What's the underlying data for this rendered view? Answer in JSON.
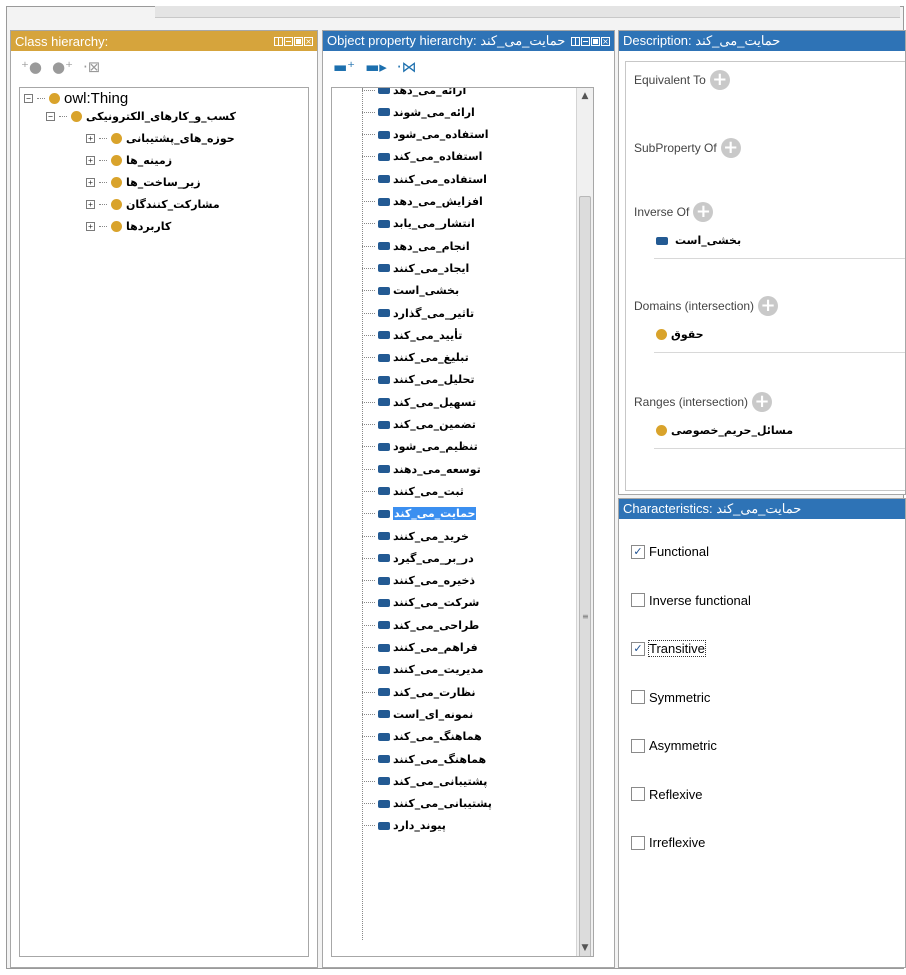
{
  "class_hierarchy": {
    "title": "Class hierarchy:",
    "root": "owl:Thing",
    "parent": "کسب_و_کارهای_الکترونیکی",
    "children": [
      "حوزه_های_پشتیبانی",
      "زمینه_ها",
      "زیر_ساخت_ها",
      "مشارکت_کنندگان",
      "کاربردها"
    ]
  },
  "object_property": {
    "title": "Object property hierarchy: حمایت_می_کند",
    "items": [
      "ارائه_می_دهد",
      "ارائه_می_شوند",
      "استفاده_می_شود",
      "استفاده_می_کند",
      "استفاده_می_کنند",
      "افزایش_می_دهد",
      "انتشار_می_یابد",
      "انجام_می_دهد",
      "ایجاد_می_کنند",
      "بخشی_است",
      "تاثیر_می_گذارد",
      "تأیید_می_کند",
      "تبلیغ_می_کنند",
      "تحلیل_می_کنند",
      "تسهیل_می_کند",
      "تضمین_می_کند",
      "تنظیم_می_شود",
      "توسعه_می_دهند",
      "ثبت_می_کنند",
      "حمایت_می_کند",
      "خرید_می_کنند",
      "در_بر_می_گیرد",
      "ذخیره_می_کنند",
      "شرکت_می_کنند",
      "طراحی_می_کند",
      "فراهم_می_کنند",
      "مدیریت_می_کنند",
      "نظارت_می_کند",
      "نمونه_ای_است",
      "هماهنگ_می_کند",
      "هماهنگ_می_کنند",
      "پشتیبانی_می_کند",
      "پشتیبانی_می_کنند",
      "پیوند_دارد"
    ],
    "selected_index": 19
  },
  "description": {
    "title": "Description: حمایت_می_کند",
    "equivalent_to": "Equivalent To",
    "subproperty_of": "SubProperty Of",
    "inverse_of": "Inverse Of",
    "inverse_value": "بخشی_است",
    "domains": "Domains (intersection)",
    "domain_value": "حقوق",
    "ranges": "Ranges (intersection)",
    "range_value": "مسائل_حریم_خصوصی"
  },
  "characteristics": {
    "title": "Characteristics: حمایت_می_کند",
    "items": [
      {
        "label": "Functional",
        "checked": true
      },
      {
        "label": "Inverse functional",
        "checked": false
      },
      {
        "label": "Transitive",
        "checked": true
      },
      {
        "label": "Symmetric",
        "checked": false
      },
      {
        "label": "Asymmetric",
        "checked": false
      },
      {
        "label": "Reflexive",
        "checked": false
      },
      {
        "label": "Irreflexive",
        "checked": false
      }
    ]
  },
  "colors": {
    "class_header": "#d6a43c",
    "property_header": "#2e73b6",
    "class_dot": "#d9a32b",
    "property_icon": "#235a93",
    "selection": "#3b8ff0"
  },
  "icons": {
    "class_toolbar": [
      "add-subclass-icon",
      "add-sibling-icon",
      "delete-class-icon"
    ],
    "property_toolbar": [
      "add-subproperty-icon",
      "add-sibling-property-icon",
      "delete-property-icon"
    ]
  }
}
